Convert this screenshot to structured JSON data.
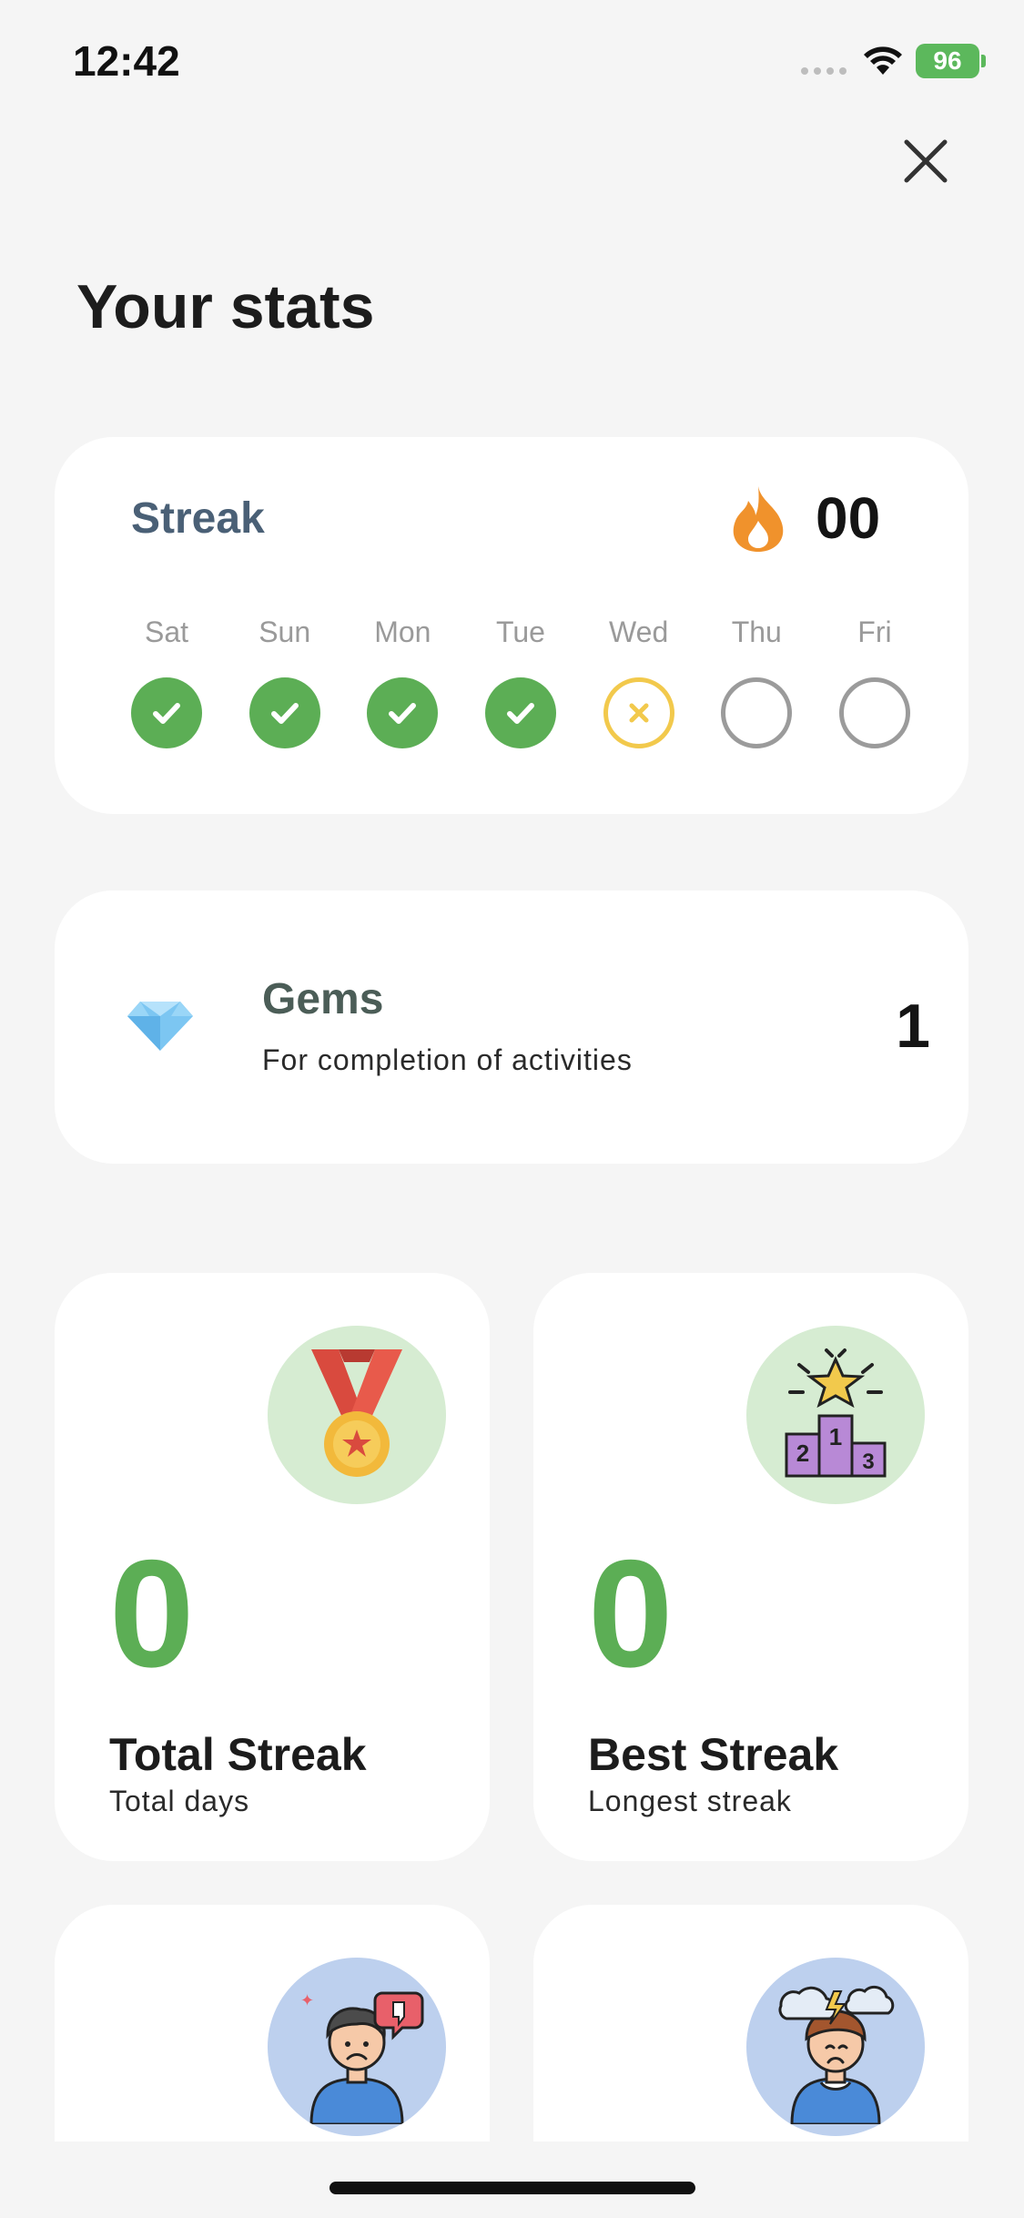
{
  "status_bar": {
    "time": "12:42",
    "battery": "96"
  },
  "header": {
    "title": "Your stats"
  },
  "streak": {
    "label": "Streak",
    "count": "00",
    "days": [
      {
        "label": "Sat",
        "state": "done"
      },
      {
        "label": "Sun",
        "state": "done"
      },
      {
        "label": "Mon",
        "state": "done"
      },
      {
        "label": "Tue",
        "state": "done"
      },
      {
        "label": "Wed",
        "state": "missed"
      },
      {
        "label": "Thu",
        "state": "pending"
      },
      {
        "label": "Fri",
        "state": "pending"
      }
    ]
  },
  "gems": {
    "title": "Gems",
    "subtitle": "For completion of activities",
    "count": "1"
  },
  "stats": {
    "total": {
      "value": "0",
      "title": "Total Streak",
      "subtitle": "Total days",
      "icon": "medal-icon"
    },
    "best": {
      "value": "0",
      "title": "Best Streak",
      "subtitle": "Longest streak",
      "icon": "podium-icon"
    }
  },
  "lower_cards": [
    {
      "icon": "disliked-person-icon"
    },
    {
      "icon": "stressed-person-icon"
    }
  ],
  "colors": {
    "accent_green": "#5cae55",
    "missed_yellow": "#f2c94c",
    "streak_label": "#4a6076",
    "flame": "#f0922c"
  }
}
